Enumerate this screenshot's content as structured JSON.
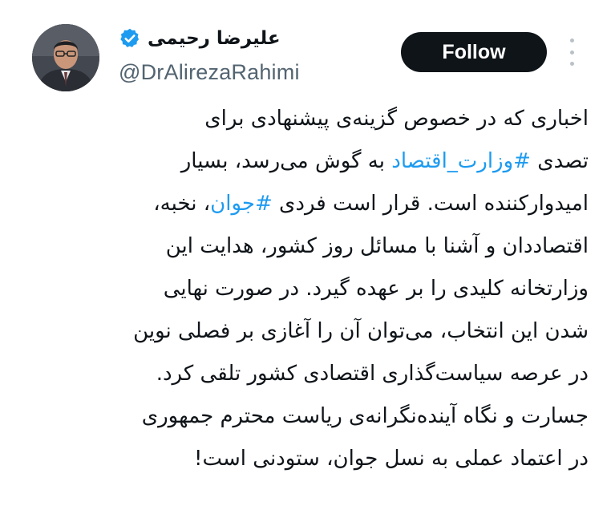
{
  "author": {
    "display_name": "علیرضا رحیمی",
    "handle": "@DrAlirezaRahimi",
    "verified": true,
    "verified_color": "#1d9bf0"
  },
  "actions": {
    "follow_label": "Follow",
    "more_icon": "more-vertical-icon"
  },
  "tweet": {
    "hashtag_color": "#1d9bf0",
    "lines": [
      [
        {
          "text": "اخباری که در خصوص گزینه‌ی پیشنهادی برای"
        }
      ],
      [
        {
          "text": "تصدی "
        },
        {
          "text": "#وزارت_اقتصاد",
          "hashtag": true
        },
        {
          "text": " به گوش می‌رسد، بسیار"
        }
      ],
      [
        {
          "text": "امیدوارکننده است. قرار است فردی "
        },
        {
          "text": "#جوان",
          "hashtag": true
        },
        {
          "text": "، نخبه،"
        }
      ],
      [
        {
          "text": "اقتصاددان و آشنا با مسائل روز کشور، هدایت این"
        }
      ],
      [
        {
          "text": "وزارتخانه کلیدی را بر عهده گیرد. در صورت نهایی"
        }
      ],
      [
        {
          "text": "شدن این انتخاب، می‌توان آن را آغازی بر فصلی نوین"
        }
      ],
      [
        {
          "text": "در عرصه سیاست‌گذاری اقتصادی کشور تلقی کرد."
        }
      ],
      [
        {
          "text": "جسارت و نگاه آینده‌نگرانه‌ی ریاست محترم جمهوری"
        }
      ],
      [
        {
          "text": "در اعتماد عملی به نسل جوان، ستودنی است!"
        }
      ]
    ]
  }
}
